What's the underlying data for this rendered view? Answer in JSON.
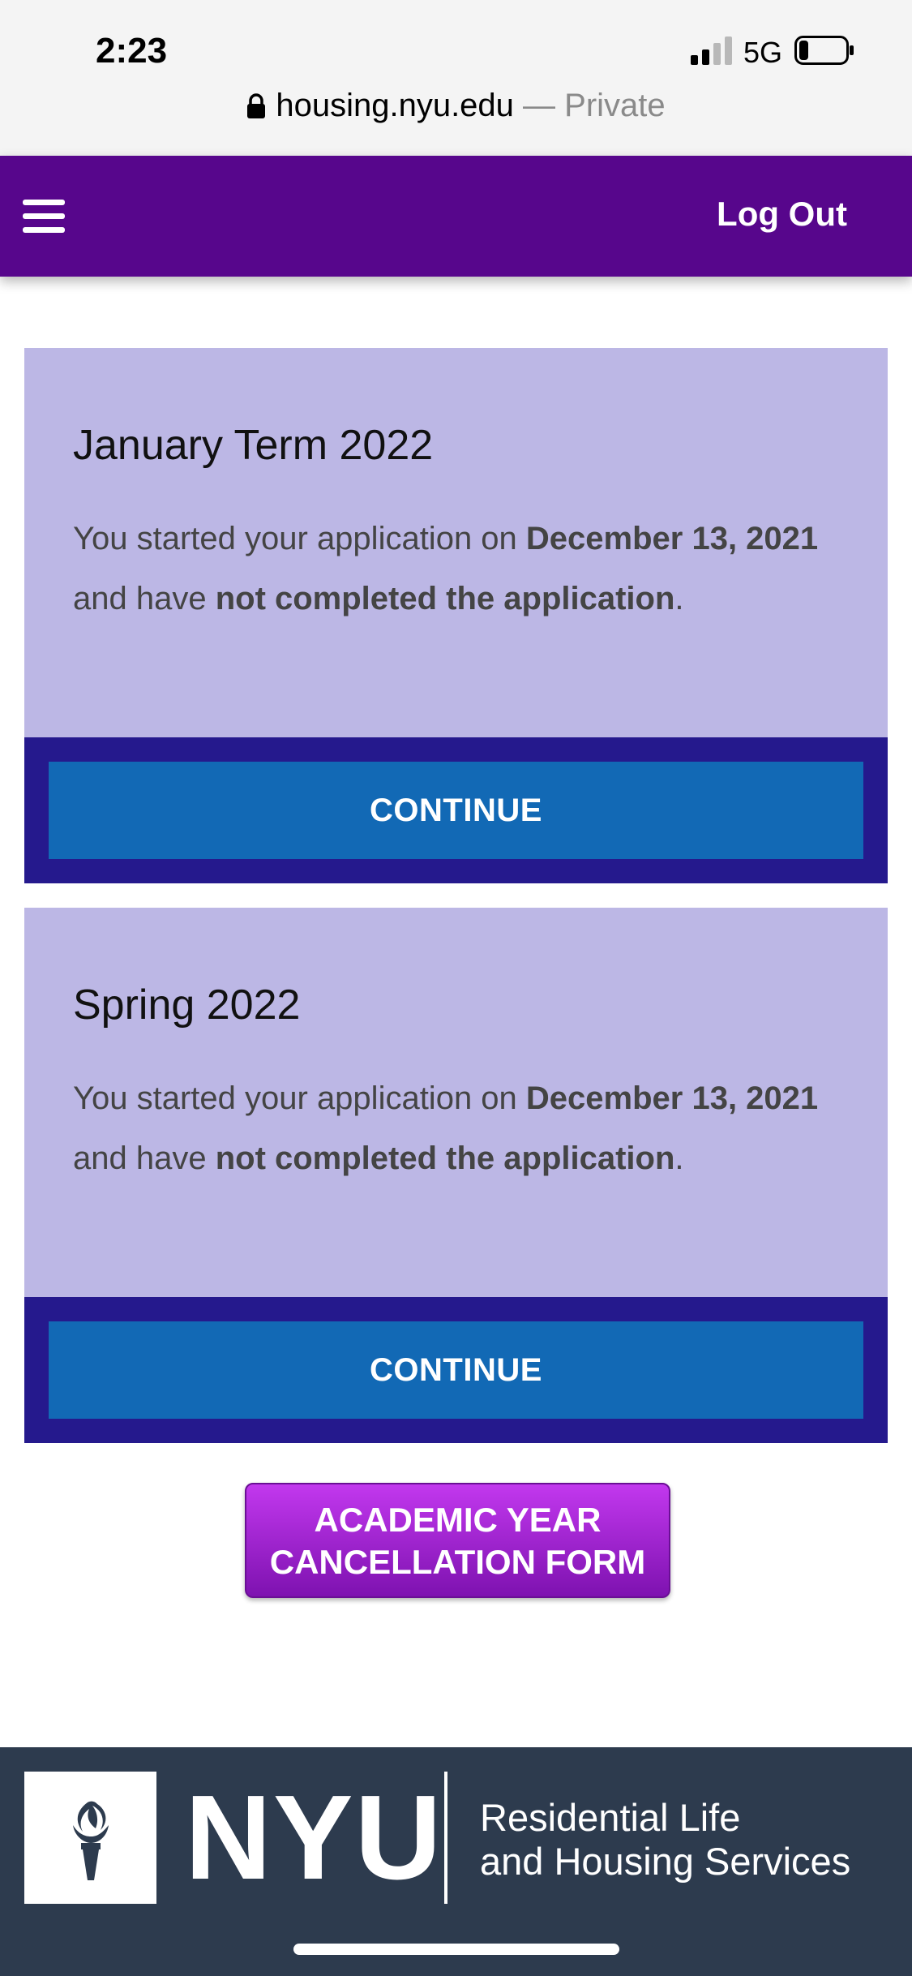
{
  "status_bar": {
    "time": "2:23",
    "network": "5G",
    "battery_level": 0.2
  },
  "browser": {
    "url": "housing.nyu.edu",
    "separator": " — ",
    "private_label": "Private"
  },
  "nav": {
    "menu_icon": "hamburger-icon",
    "logout_label": "Log Out",
    "color": "#57068c"
  },
  "applications": [
    {
      "term": "January Term 2022",
      "text_prefix": "You started your application on ",
      "date": "December 13, 2021",
      "text_middle": " and have ",
      "status": "not completed the application",
      "text_suffix": ".",
      "button_label": "CONTINUE"
    },
    {
      "term": "Spring 2022",
      "text_prefix": "You started your application on ",
      "date": "December 13, 2021",
      "text_middle": " and have ",
      "status": "not completed the application",
      "text_suffix": ".",
      "button_label": "CONTINUE"
    }
  ],
  "cancellation": {
    "line1": "ACADEMIC YEAR",
    "line2": "CANCELLATION FORM"
  },
  "footer": {
    "logo_icon": "nyu-torch-icon",
    "wordmark": "NYU",
    "line1": "Residential Life",
    "line2": "and Housing Services"
  },
  "colors": {
    "card_bg": "#bcb7e5",
    "card_footer": "#25198d",
    "button": "#1269b5",
    "footer_bg": "#2d3b4e"
  }
}
